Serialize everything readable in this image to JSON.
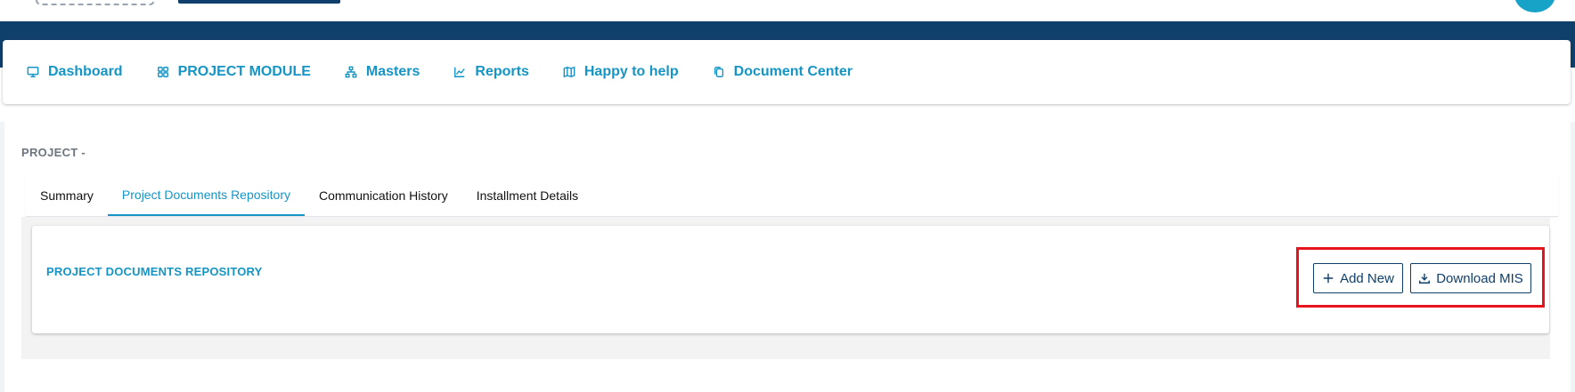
{
  "nav": {
    "items": [
      {
        "label": "Dashboard",
        "icon": "monitor-icon"
      },
      {
        "label": "PROJECT MODULE",
        "icon": "grid-icon"
      },
      {
        "label": "Masters",
        "icon": "sitemap-icon"
      },
      {
        "label": "Reports",
        "icon": "chart-icon"
      },
      {
        "label": "Happy to help",
        "icon": "map-icon"
      },
      {
        "label": "Document Center",
        "icon": "copy-icon"
      }
    ]
  },
  "project": {
    "label": "PROJECT -"
  },
  "tabs": [
    {
      "label": "Summary",
      "active": false
    },
    {
      "label": "Project Documents Repository",
      "active": true
    },
    {
      "label": "Communication History",
      "active": false
    },
    {
      "label": "Installment Details",
      "active": false
    }
  ],
  "panel": {
    "title": "PROJECT DOCUMENTS REPOSITORY",
    "add_label": "Add New",
    "download_label": "Download MIS"
  },
  "colors": {
    "brand_dark": "#0f3f6b",
    "accent": "#1595c5",
    "highlight": "#e8141d"
  }
}
